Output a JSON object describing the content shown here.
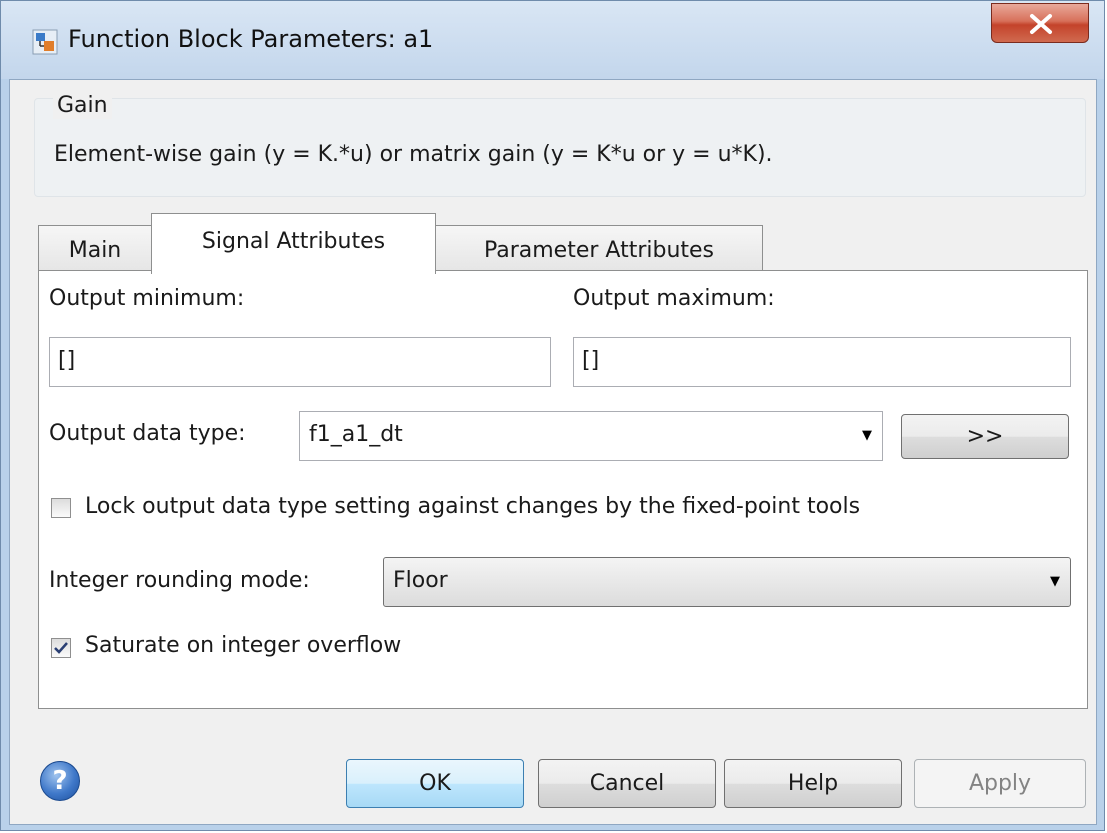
{
  "window": {
    "title": "Function Block Parameters: a1",
    "close_label": "X"
  },
  "group": {
    "title": "Gain",
    "description": "Element-wise gain (y = K.*u) or matrix gain (y = K*u or y = u*K)."
  },
  "tabs": [
    {
      "label": "Main",
      "active": false
    },
    {
      "label": "Signal Attributes",
      "active": true
    },
    {
      "label": "Parameter Attributes",
      "active": false
    }
  ],
  "signal_attributes": {
    "output_minimum_label": "Output minimum:",
    "output_minimum_value": "[]",
    "output_maximum_label": "Output maximum:",
    "output_maximum_value": "[]",
    "output_data_type_label": "Output data type:",
    "output_data_type_value": "f1_a1_dt",
    "data_type_assistant_label": ">>",
    "lock_label": "Lock output data type setting against changes by the fixed-point tools",
    "lock_checked": false,
    "rounding_label": "Integer rounding mode:",
    "rounding_value": "Floor",
    "saturate_label": "Saturate on integer overflow",
    "saturate_checked": true
  },
  "footer": {
    "help_icon": "question-mark",
    "ok_label": "OK",
    "cancel_label": "Cancel",
    "help_label": "Help",
    "apply_label": "Apply",
    "apply_enabled": false
  },
  "colors": {
    "title_bar": "#c3d6ec",
    "close_button": "#c4432b",
    "ok_button_border": "#3c7fb1"
  }
}
